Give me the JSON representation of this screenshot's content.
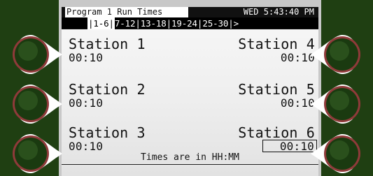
{
  "status_bar": {
    "program_title": "Program 1 Run Times",
    "datetime": "WED 5:43:40 PM"
  },
  "tabs": [
    {
      "label": "|1-6|",
      "active": true
    },
    {
      "label": "7-12|",
      "active": false
    },
    {
      "label": "13-18|",
      "active": false
    },
    {
      "label": "19-24|",
      "active": false
    },
    {
      "label": "25-30|",
      "active": false
    },
    {
      "label": ">",
      "active": false
    }
  ],
  "stations": [
    {
      "name": "Station 1",
      "time": "00:10"
    },
    {
      "name": "Station 2",
      "time": "00:10"
    },
    {
      "name": "Station 3",
      "time": "00:10"
    },
    {
      "name": "Station 4",
      "time": "00:10"
    },
    {
      "name": "Station 5",
      "time": "00:10"
    },
    {
      "name": "Station 6",
      "time": "00:10"
    }
  ],
  "footer": {
    "note": "Times are in HH:MM"
  },
  "side_buttons": {
    "icon": "pointer-button-icon"
  },
  "colors": {
    "background": "#1f3f12",
    "screen": "#efefef",
    "bezel": "#c8c8c8",
    "button_green": "#1a3a10",
    "button_ring": "#b55a5a",
    "text_dark": "#121212"
  }
}
